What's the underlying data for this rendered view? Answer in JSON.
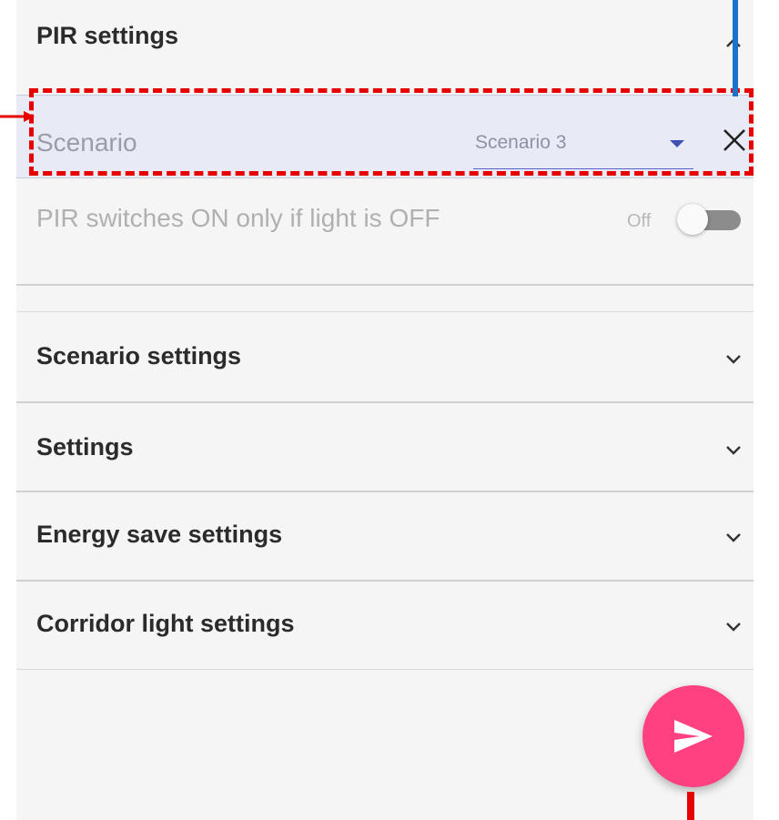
{
  "pir_settings": {
    "title": "PIR settings",
    "scenario": {
      "label": "Scenario",
      "selected": "Scenario 3"
    },
    "switch": {
      "label": "PIR switches ON only if light is OFF",
      "state_label": "Off"
    }
  },
  "sections": [
    {
      "title": "Scenario settings"
    },
    {
      "title": "Settings"
    },
    {
      "title": "Energy save settings"
    },
    {
      "title": "Corridor light settings"
    }
  ],
  "colors": {
    "accent": "#3f51b5",
    "fab": "#ff4081",
    "annotation_red": "#e60000",
    "annotation_blue": "#1a73c8"
  },
  "icons": {
    "collapse": "chevron-up-icon",
    "expand": "chevron-down-icon",
    "clear": "close-icon",
    "send": "send-icon"
  }
}
